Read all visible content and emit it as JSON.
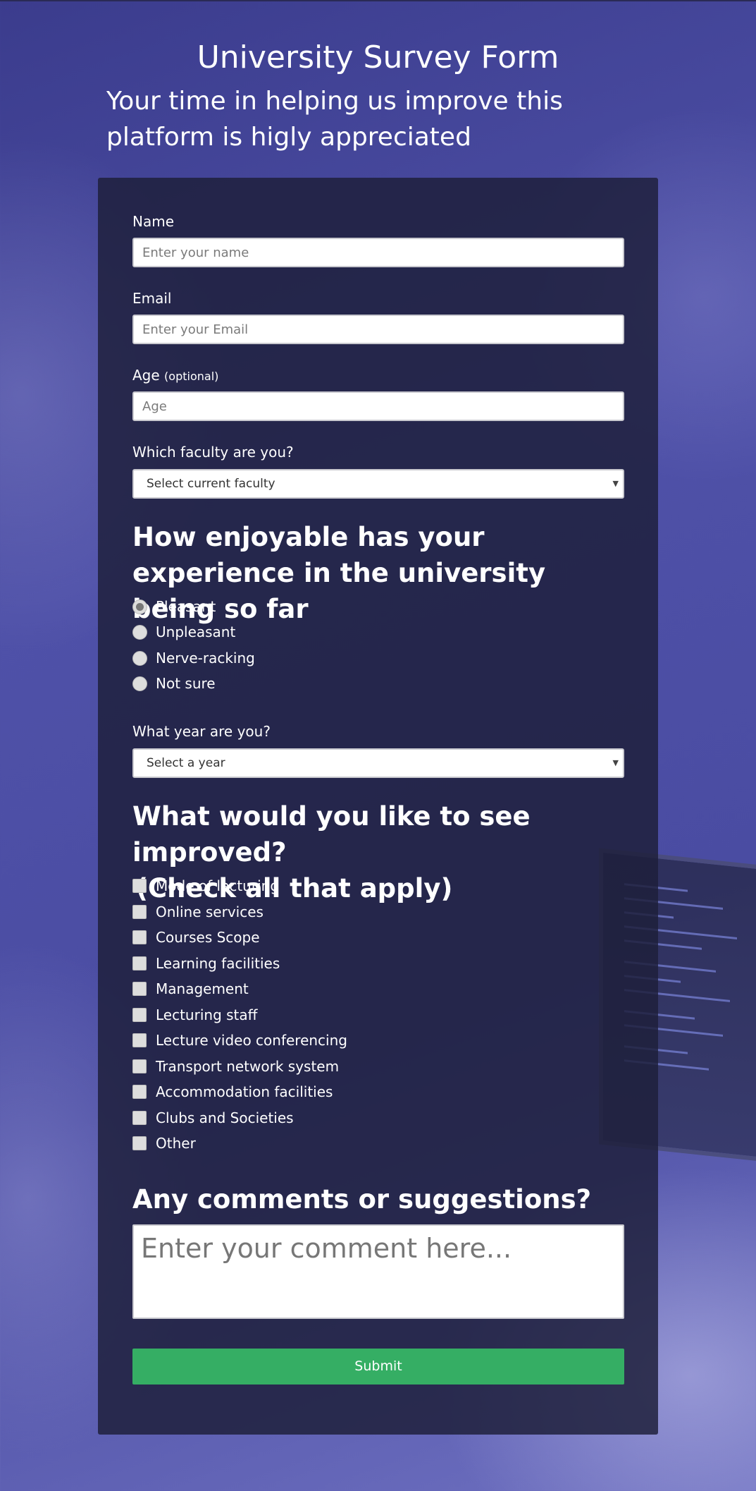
{
  "header": {
    "title": "University Survey Form",
    "description": "Your time in helping us improve this platform is higly appreciated"
  },
  "form": {
    "name": {
      "label": "Name",
      "placeholder": "Enter your name"
    },
    "email": {
      "label": "Email",
      "placeholder": "Enter your Email"
    },
    "age": {
      "label": "Age",
      "optional": "(optional)",
      "placeholder": "Age"
    },
    "faculty": {
      "label": "Which faculty are you?",
      "selected": "Select current faculty"
    },
    "experience": {
      "question": "How enjoyable has your experience in the university being so far",
      "options": [
        "Pleasant",
        "Unpleasant",
        "Nerve-racking",
        "Not sure"
      ],
      "selected_index": 0
    },
    "year": {
      "label": "What year are you?",
      "selected": "Select a year"
    },
    "improvements": {
      "question": "What would you like to see improved?",
      "hint": "(Check all that apply)",
      "options": [
        "Mode of lecturing",
        "Online services",
        "Courses Scope",
        "Learning facilities",
        "Management",
        "Lecturing staff",
        "Lecture video conferencing",
        "Transport network system",
        "Accommodation facilities",
        "Clubs and Societies",
        "Other"
      ]
    },
    "comments": {
      "question": "Any comments or suggestions?",
      "placeholder": "Enter your comment here..."
    },
    "submit_label": "Submit"
  },
  "colors": {
    "card_background": "#1e1f3a",
    "submit_green": "#35ae64",
    "page_background": "#4f51a8"
  },
  "icons": {
    "select_caret": "caret-down-icon"
  }
}
